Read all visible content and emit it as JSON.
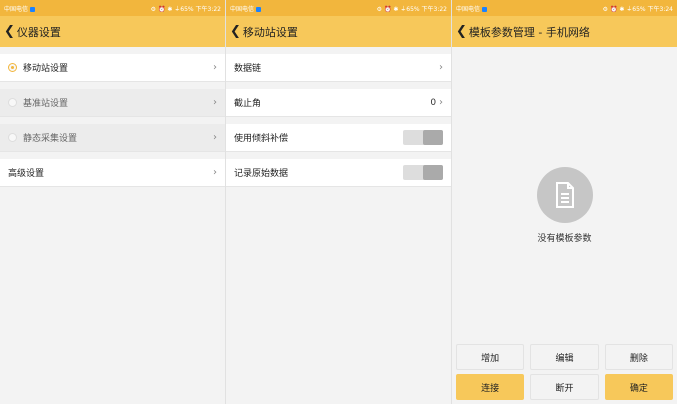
{
  "status": {
    "carrier": "中国电信",
    "indicators1": "⚙ ⏰ ✱ ⏚65%",
    "time1": "下午3:22",
    "time2": "下午3:22",
    "time3": "下午3:24"
  },
  "s1": {
    "title": "仪器设置",
    "items": [
      {
        "label": "移动站设置"
      },
      {
        "label": "基准站设置"
      },
      {
        "label": "静态采集设置"
      },
      {
        "label": "高级设置"
      }
    ]
  },
  "s2": {
    "title": "移动站设置",
    "items": [
      {
        "label": "数据链"
      },
      {
        "label": "截止角",
        "value": "0"
      },
      {
        "label": "使用倾斜补偿"
      },
      {
        "label": "记录原始数据"
      }
    ]
  },
  "s3": {
    "title": "模板参数管理 - 手机网络",
    "empty_text": "没有模板参数",
    "buttons": {
      "add": "增加",
      "edit": "编辑",
      "delete": "删除",
      "connect": "连接",
      "disconnect": "断开",
      "ok": "确定"
    }
  },
  "colors": {
    "accent": "#f7c85a",
    "statusbar": "#f2b63d"
  }
}
